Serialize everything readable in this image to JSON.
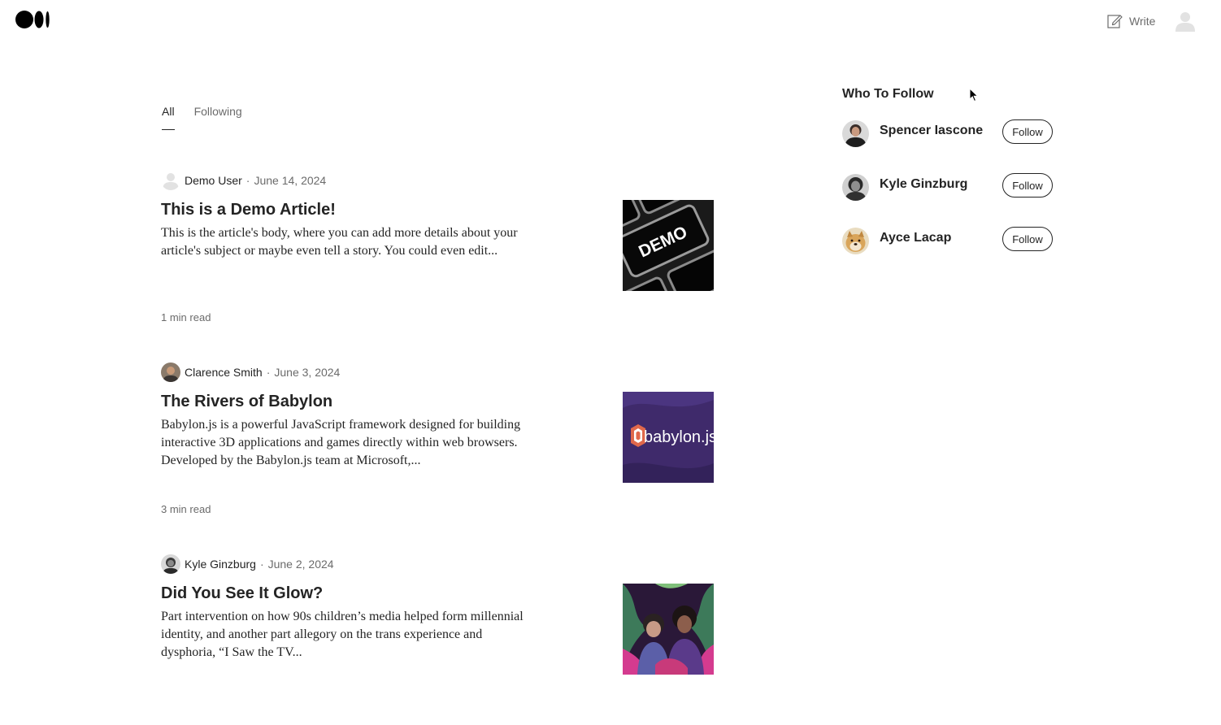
{
  "header": {
    "logo_icon": "medium-logo-icon",
    "write_label": "Write",
    "write_icon": "edit-icon",
    "avatar_icon": "user-avatar-icon"
  },
  "tabs": [
    {
      "label": "All",
      "active": true
    },
    {
      "label": "Following",
      "active": false
    }
  ],
  "articles": [
    {
      "author": "Demo User",
      "separator": "·",
      "date": "June 14, 2024",
      "title": "This is a Demo Article!",
      "excerpt": "This is the article's body, where you can add more details about your article's subject or maybe even tell a story. You could even edit...",
      "read_time": "1 min read",
      "thumbnail_icon": "demo-keyboard-image",
      "thumbnail_text": "DEMO"
    },
    {
      "author": "Clarence Smith",
      "separator": "·",
      "date": "June 3, 2024",
      "title": "The Rivers of Babylon",
      "excerpt": "Babylon.js is a powerful JavaScript framework designed for building interactive 3D applications and games directly within web browsers. Developed by the Babylon.js team at Microsoft,...",
      "read_time": "3 min read",
      "thumbnail_icon": "babylonjs-logo-image",
      "thumbnail_text": "babylon.js"
    },
    {
      "author": "Kyle Ginzburg",
      "separator": "·",
      "date": "June 2, 2024",
      "title": "Did You See It Glow?",
      "excerpt": "Part intervention on how 90s children’s media helped form millennial identity, and another part allegory on the trans experience and dysphoria, “I Saw the TV...",
      "read_time": "",
      "thumbnail_icon": "tv-glow-poster-image"
    }
  ],
  "who_to_follow": {
    "title": "Who To Follow",
    "button_label": "Follow",
    "people": [
      {
        "name": "Spencer Iascone",
        "avatar_icon": "spencer-avatar"
      },
      {
        "name": "Kyle Ginzburg",
        "avatar_icon": "kyle-avatar"
      },
      {
        "name": "Ayce Lacap",
        "avatar_icon": "doge-avatar"
      }
    ]
  },
  "colors": {
    "text": "#242424",
    "muted": "#6b6b6b",
    "background": "#ffffff",
    "babylon_purple": "#3f2a6b"
  }
}
